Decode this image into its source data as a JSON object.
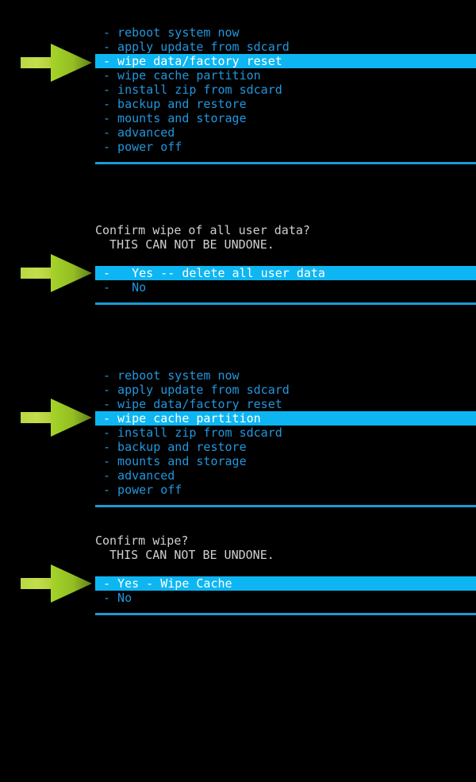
{
  "screen": {
    "title": "Android Recovery (ClockworkMod) wipe sequence",
    "background_color": "#000000",
    "menu_text_color": "#2196dd",
    "header_text_color": "#cfcfcf",
    "highlight_background_color": "#0db6f2",
    "highlight_text_color": "#ffffff",
    "rule_color": "#1c9ad6",
    "arrow_color": "#b5d334"
  },
  "panels": [
    {
      "id": "main-menu-wipe-data",
      "name": "recovery-main-menu",
      "headers": [],
      "items": [
        {
          "label": "- reboot system now",
          "selected": false
        },
        {
          "label": "- apply update from sdcard",
          "selected": false
        },
        {
          "label": "- wipe data/factory reset",
          "selected": true
        },
        {
          "label": "- wipe cache partition",
          "selected": false
        },
        {
          "label": "- install zip from sdcard",
          "selected": false
        },
        {
          "label": "- backup and restore",
          "selected": false
        },
        {
          "label": "- mounts and storage",
          "selected": false
        },
        {
          "label": "- advanced",
          "selected": false
        },
        {
          "label": "- power off",
          "selected": false
        }
      ]
    },
    {
      "id": "confirm-wipe-user-data",
      "name": "confirm-wipe-data-dialog",
      "headers": [
        "Confirm wipe of all user data?",
        "  THIS CAN NOT BE UNDONE."
      ],
      "items": [
        {
          "label": "-   Yes -- delete all user data",
          "selected": true
        },
        {
          "label": "-   No",
          "selected": false
        }
      ]
    },
    {
      "id": "main-menu-wipe-cache",
      "name": "recovery-main-menu",
      "headers": [],
      "items": [
        {
          "label": "- reboot system now",
          "selected": false
        },
        {
          "label": "- apply update from sdcard",
          "selected": false
        },
        {
          "label": "- wipe data/factory reset",
          "selected": false
        },
        {
          "label": "- wipe cache partition",
          "selected": true
        },
        {
          "label": "- install zip from sdcard",
          "selected": false
        },
        {
          "label": "- backup and restore",
          "selected": false
        },
        {
          "label": "- mounts and storage",
          "selected": false
        },
        {
          "label": "- advanced",
          "selected": false
        },
        {
          "label": "- power off",
          "selected": false
        }
      ]
    },
    {
      "id": "confirm-wipe-cache",
      "name": "confirm-wipe-cache-dialog",
      "headers": [
        "Confirm wipe?",
        "  THIS CAN NOT BE UNDONE."
      ],
      "items": [
        {
          "label": "- Yes - Wipe Cache",
          "selected": true
        },
        {
          "label": "- No",
          "selected": false
        }
      ]
    }
  ],
  "annotations": {
    "arrows": [
      {
        "name": "pointer-arrow-wipe-data",
        "points_to": "- wipe data/factory reset"
      },
      {
        "name": "pointer-arrow-yes-delete-all-user-data",
        "points_to": "-   Yes -- delete all user data"
      },
      {
        "name": "pointer-arrow-wipe-cache-partition",
        "points_to": "- wipe cache partition"
      },
      {
        "name": "pointer-arrow-yes-wipe-cache",
        "points_to": "- Yes - Wipe Cache"
      }
    ]
  }
}
